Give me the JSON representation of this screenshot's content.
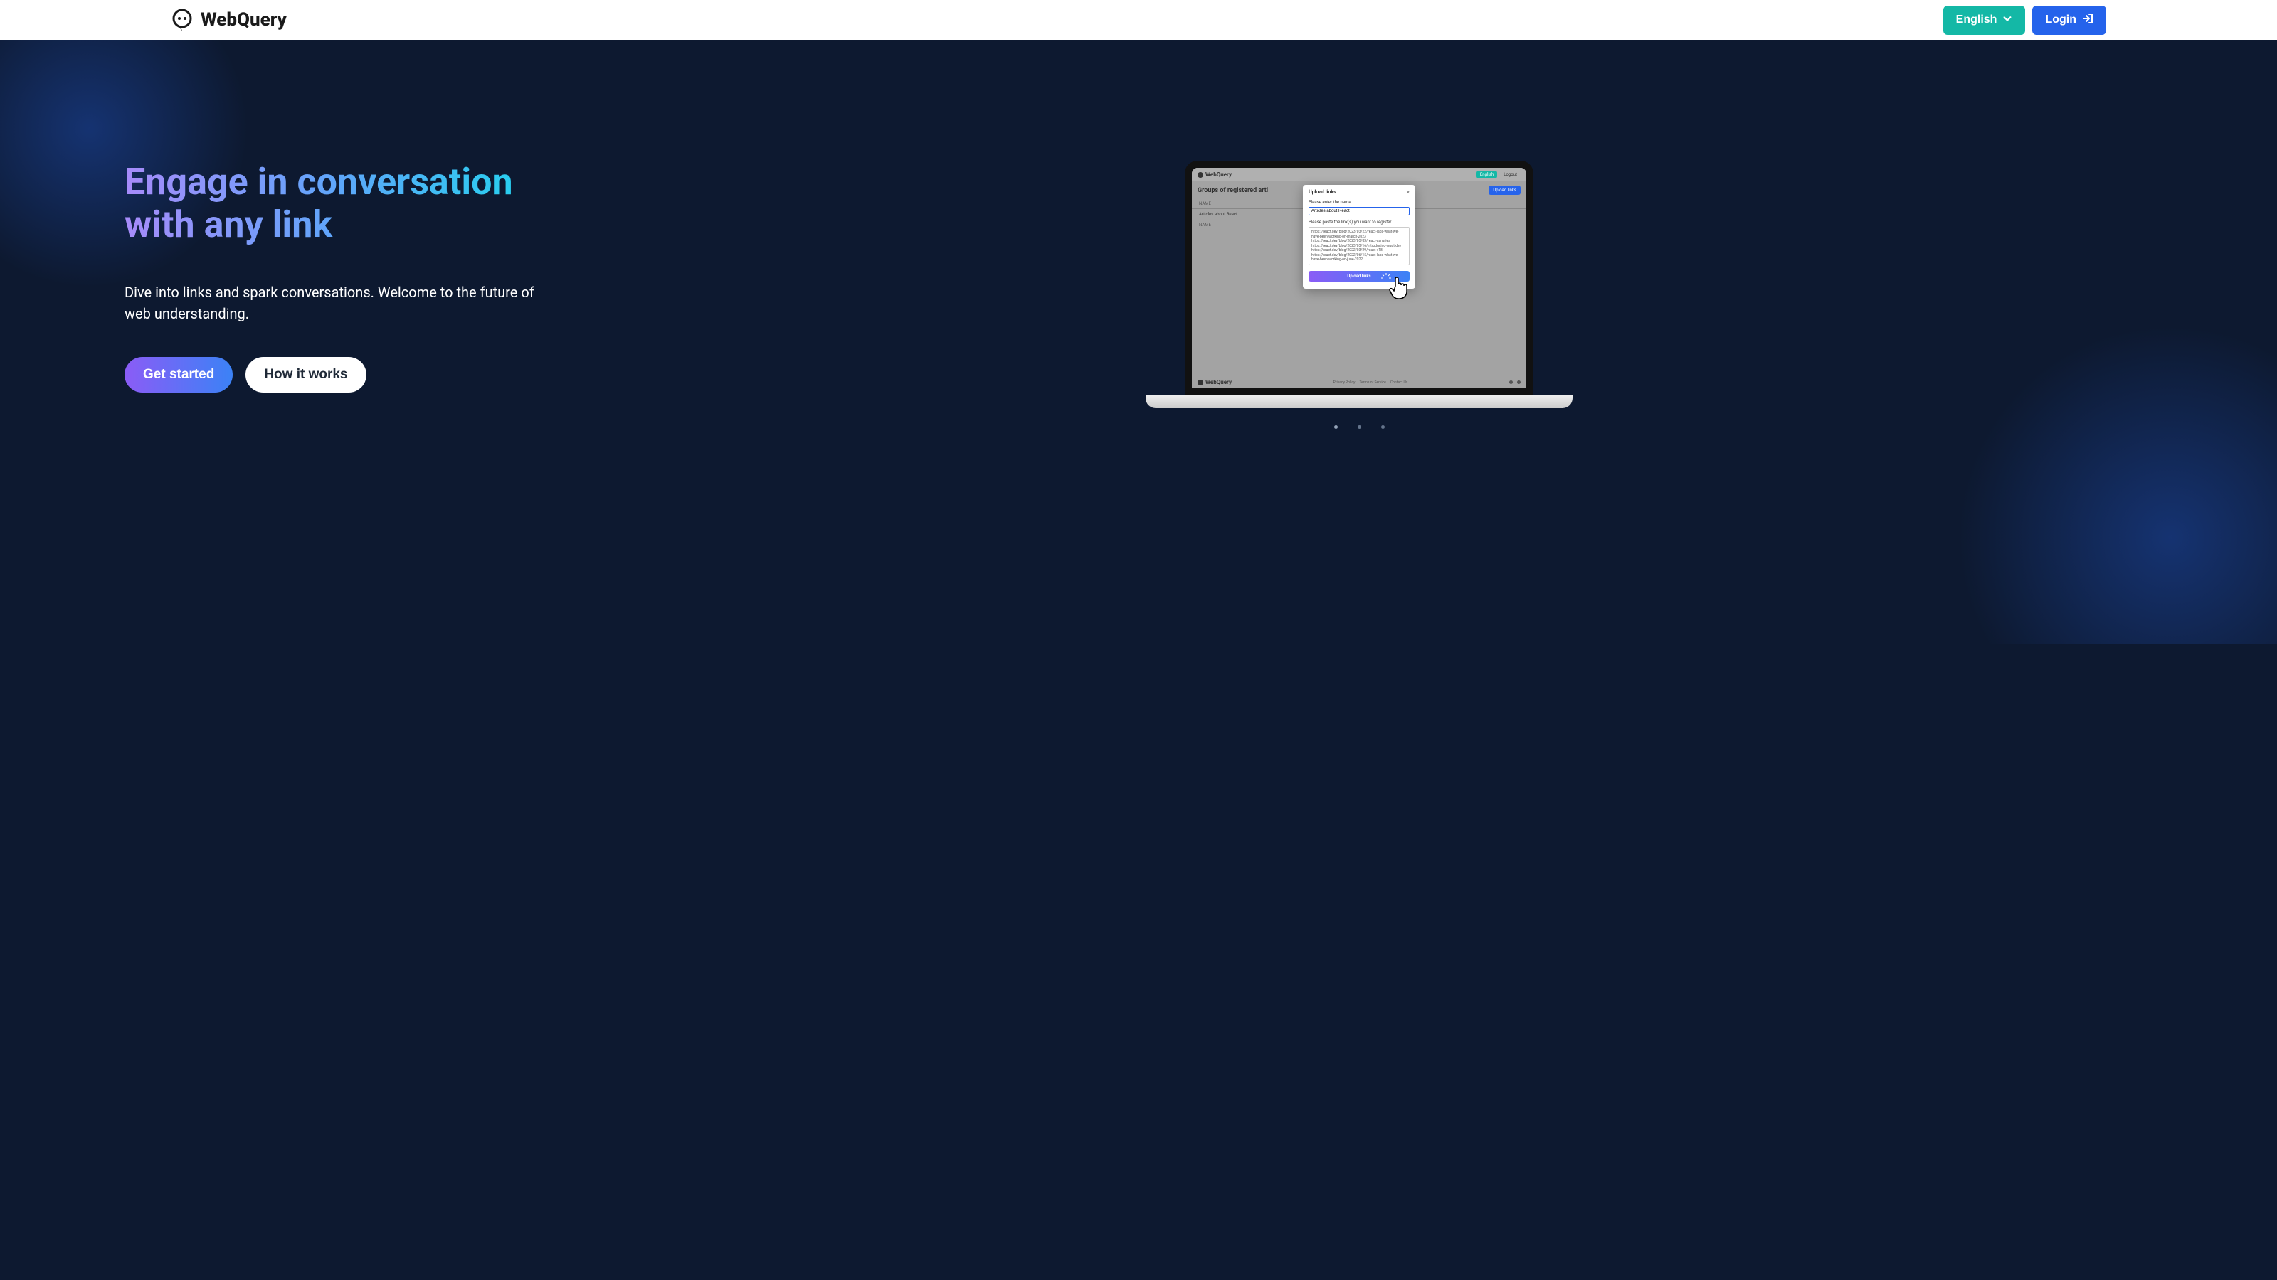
{
  "header": {
    "brand": "WebQuery",
    "language_label": "English",
    "login_label": "Login"
  },
  "hero": {
    "title_line1": "Engage in conversation",
    "title_line2": "with any link",
    "subtitle": "Dive into links and spark conversations. Welcome to the future of web understanding.",
    "cta_primary": "Get started",
    "cta_secondary": "How it works"
  },
  "laptop_app": {
    "brand": "WebQuery",
    "english_label": "English",
    "logout_label": "Logout",
    "section_title": "Groups of registered arti",
    "upload_links_btn": "Upload links",
    "table": {
      "col_name": "NAME",
      "row1": "Articles about React",
      "row2_col": "NAME"
    },
    "footer": {
      "brand": "WebQuery",
      "privacy": "Privacy Policy",
      "terms": "Terms of Service",
      "contact": "Contact Us"
    },
    "modal": {
      "title": "Upload links",
      "name_label": "Please enter the name",
      "name_value": "Articles about React",
      "links_label": "Please paste the link(s) you want to register",
      "links_value": "https://react.dev/blog/2023/03/22/react-labs-what-we-have-been-working-on-march-2023\nhttps://react.dev/blog/2023/05/03/react-canaries\nhttps://react.dev/blog/2023/03/16/introducing-react-dev\nhttps://react.dev/blog/2022/03/29/react-v18\nhttps://react.dev/blog/2022/06/15/react-labs-what-we-have-been-working-on-june-2022",
      "submit_label": "Upload links"
    }
  }
}
